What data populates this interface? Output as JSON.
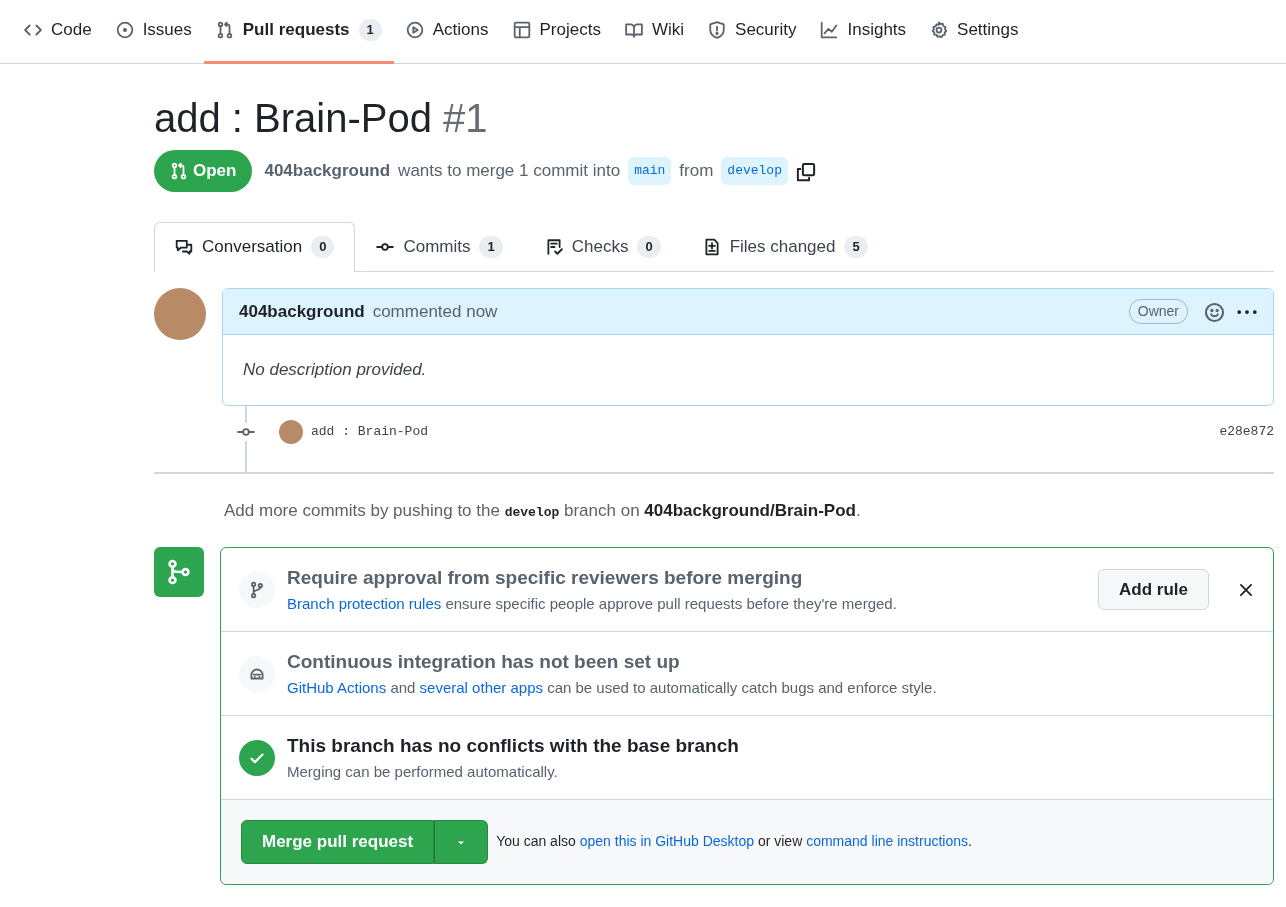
{
  "repo_nav": [
    {
      "label": "Code",
      "selected": false
    },
    {
      "label": "Issues",
      "selected": false
    },
    {
      "label": "Pull requests",
      "count": "1",
      "selected": true
    },
    {
      "label": "Actions",
      "selected": false
    },
    {
      "label": "Projects",
      "selected": false
    },
    {
      "label": "Wiki",
      "selected": false
    },
    {
      "label": "Security",
      "selected": false
    },
    {
      "label": "Insights",
      "selected": false
    },
    {
      "label": "Settings",
      "selected": false
    }
  ],
  "pr": {
    "title": "add : Brain-Pod",
    "number": "#1",
    "state": "Open",
    "author": "404background",
    "merge_text": "wants to merge 1 commit into",
    "base": "main",
    "from_text": "from",
    "head": "develop"
  },
  "pr_tabs": [
    {
      "label": "Conversation",
      "count": "0",
      "selected": true
    },
    {
      "label": "Commits",
      "count": "1",
      "selected": false
    },
    {
      "label": "Checks",
      "count": "0",
      "selected": false
    },
    {
      "label": "Files changed",
      "count": "5",
      "selected": false
    }
  ],
  "comment": {
    "author": "404background",
    "action": "commented now",
    "role": "Owner",
    "body": "No description provided."
  },
  "commit": {
    "message": "add : Brain-Pod",
    "sha": "e28e872"
  },
  "push_hint": [
    {
      "kind": "text",
      "text": "Add more commits by pushing to the "
    },
    {
      "kind": "code",
      "text": "develop"
    },
    {
      "kind": "text",
      "text": " branch on "
    },
    {
      "kind": "bold",
      "text": "404background/Brain-Pod"
    },
    {
      "kind": "text",
      "text": "."
    }
  ],
  "merge_box": {
    "sections": [
      {
        "kind": "protection",
        "title": "Require approval from specific reviewers before merging",
        "description": [
          {
            "kind": "link",
            "text": "Branch protection rules"
          },
          {
            "kind": "text",
            "text": " ensure specific people approve pull requests before they're merged."
          }
        ],
        "button": "Add rule"
      },
      {
        "kind": "ci",
        "title": "Continuous integration has not been set up",
        "description": [
          {
            "kind": "link",
            "text": "GitHub Actions"
          },
          {
            "kind": "text",
            "text": " and "
          },
          {
            "kind": "link",
            "text": "several other apps"
          },
          {
            "kind": "text",
            "text": " can be used to automatically catch bugs and enforce style."
          }
        ]
      },
      {
        "kind": "ok",
        "title": "This branch has no conflicts with the base branch",
        "description": [
          {
            "kind": "text",
            "text": "Merging can be performed automatically."
          }
        ]
      }
    ],
    "merge_button": "Merge pull request",
    "alt_text": [
      {
        "kind": "text",
        "text": "You can also "
      },
      {
        "kind": "link",
        "text": "open this in GitHub Desktop"
      },
      {
        "kind": "text",
        "text": " or view "
      },
      {
        "kind": "link",
        "text": "command line instructions"
      },
      {
        "kind": "text",
        "text": "."
      }
    ]
  }
}
